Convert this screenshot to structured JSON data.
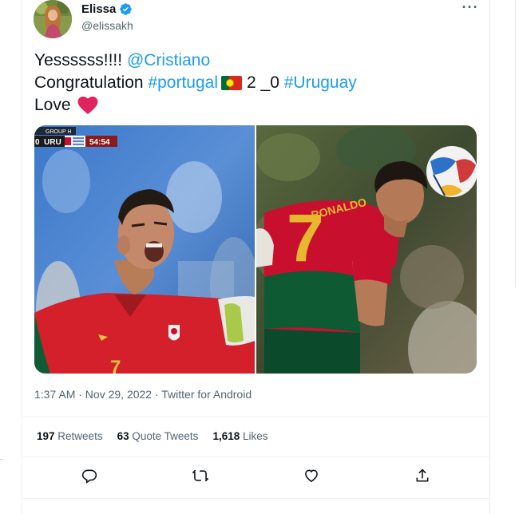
{
  "tweet": {
    "author": {
      "display_name": "Elissa",
      "handle": "@elissakh",
      "verified": true,
      "avatar_icon": "avatar-photo"
    },
    "text": {
      "line1_plain": "Yessssss!!!! ",
      "line1_mention": "@Cristiano",
      "line2_plain": "Congratulation ",
      "line2_hashtag1": "#portugal",
      "line2_score": "2 _0 ",
      "line2_hashtag2": "#Uruguay",
      "line3_plain": "Love"
    },
    "media": {
      "left_photo": {
        "scoreboard_team": "URU",
        "scoreboard_left_digit": "0",
        "scoreboard_clock": "54:54",
        "scoreboard_group": "GROUP H",
        "jersey_number": "7"
      },
      "right_photo": {
        "jersey_name": "RONALDO",
        "jersey_number": "7"
      }
    },
    "timestamp": "1:37 AM · Nov 29, 2022 · Twitter for Android",
    "stats": {
      "retweets_count": "197",
      "retweets_label": "Retweets",
      "quotes_count": "63",
      "quotes_label": "Quote Tweets",
      "likes_count": "1,618",
      "likes_label": "Likes"
    },
    "actions": [
      "reply-icon",
      "retweet-icon",
      "like-icon",
      "share-icon"
    ],
    "colors": {
      "link": "#1d9bf0",
      "secondary_text": "#536471",
      "heart": "#e0245e",
      "portugal_red": "#c8102e"
    }
  }
}
